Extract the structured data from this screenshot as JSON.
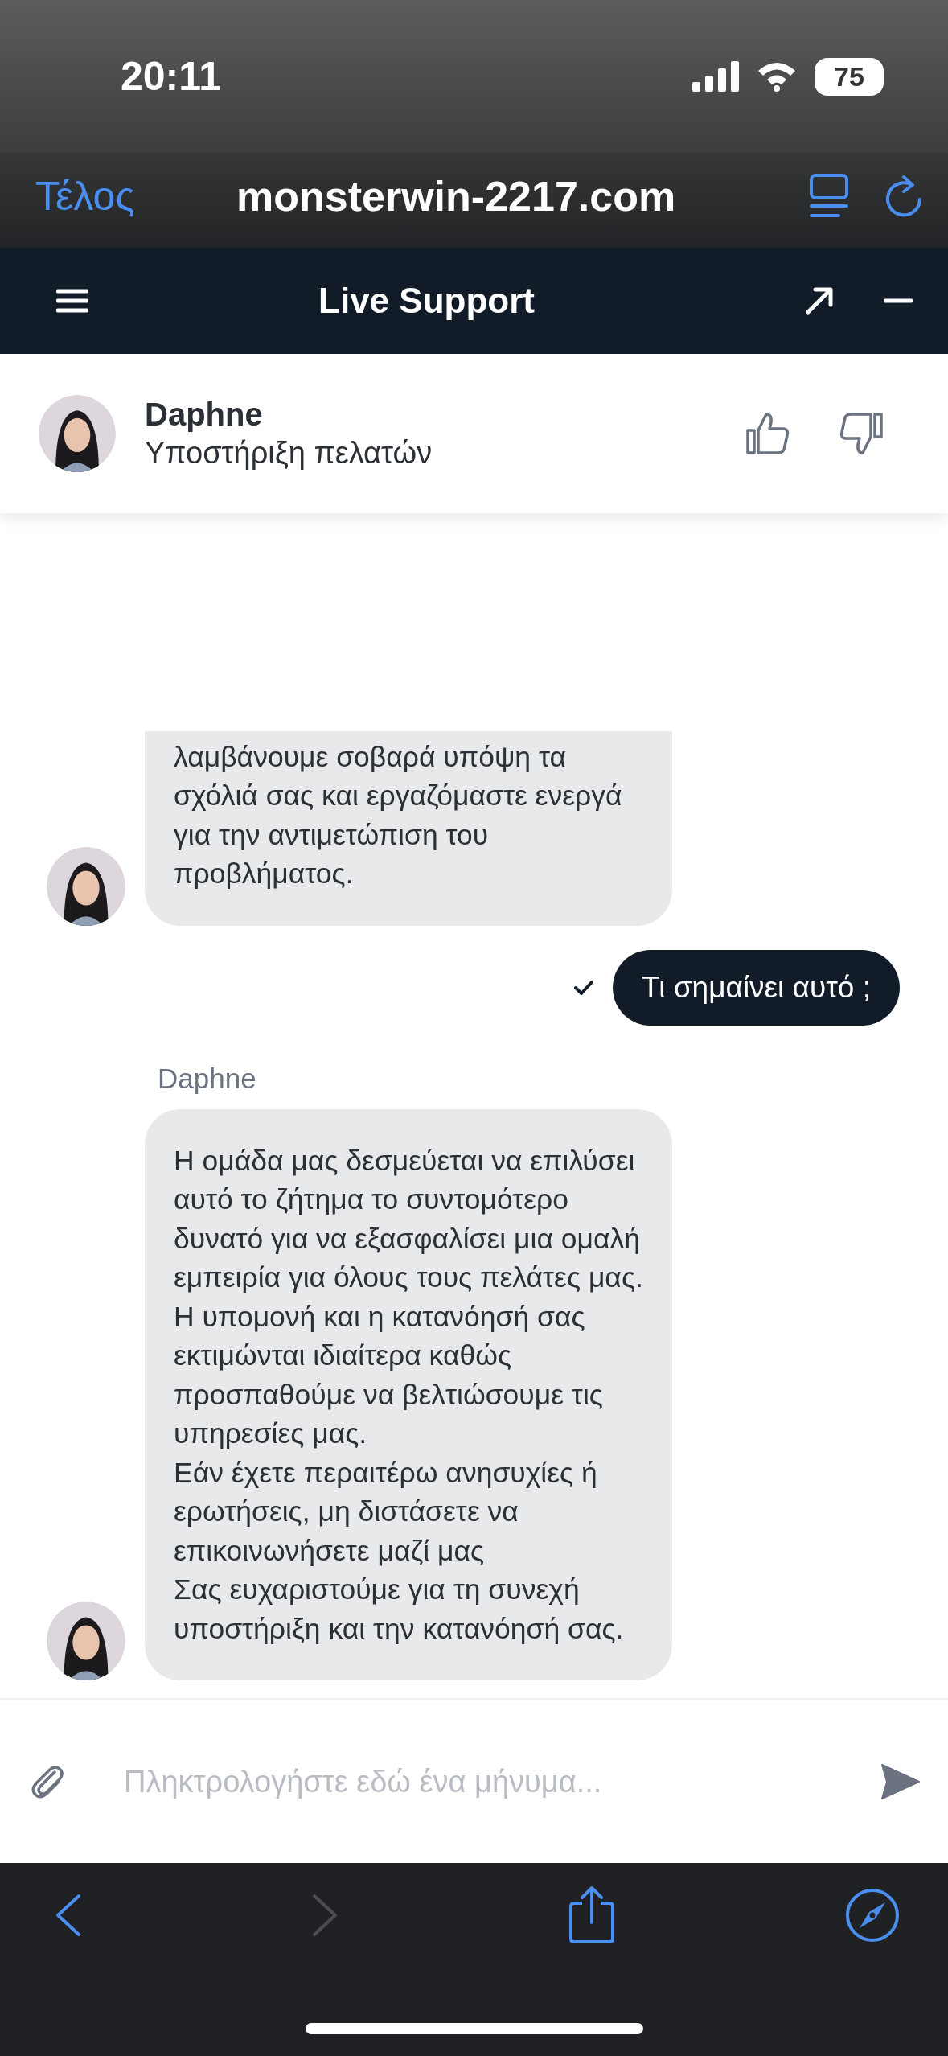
{
  "status_bar": {
    "time": "20:11",
    "battery": "75"
  },
  "browser_bar": {
    "done": "Τέλος",
    "url": "monsterwin-2217.com"
  },
  "chat_header": {
    "title": "Live Support"
  },
  "agent": {
    "name": "Daphne",
    "role": "Υποστήριξη πελατών"
  },
  "messages": [
    {
      "kind": "agent",
      "text": "λαμβάνουμε σοβαρά υπόψη τα σχόλιά σας και εργαζόμαστε ενεργά για την αντιμετώπιση του προβλήματος."
    },
    {
      "kind": "user",
      "text": "Τι σημαίνει αυτό ;",
      "delivered": true
    },
    {
      "kind": "agent",
      "sender": "Daphne",
      "text": "Η ομάδα μας δεσμεύεται να επιλύσει αυτό το ζήτημα το συντομότερο δυνατό για να εξασφαλίσει μια ομαλή εμπειρία για όλους τους πελάτες μας. Η υπομονή και η κατανόησή σας εκτιμώνται ιδιαίτερα καθώς προσπαθούμε να βελτιώσουμε τις υπηρεσίες μας.\nΕάν έχετε περαιτέρω ανησυχίες ή ερωτήσεις, μη διστάσετε να επικοινωνήσετε μαζί μας\nΣας ευχαριστούμε για τη συνεχή υποστήριξη και την κατανόησή σας."
    }
  ],
  "composer": {
    "placeholder": "Πληκτρολογήστε εδώ ένα μήνυμα..."
  }
}
